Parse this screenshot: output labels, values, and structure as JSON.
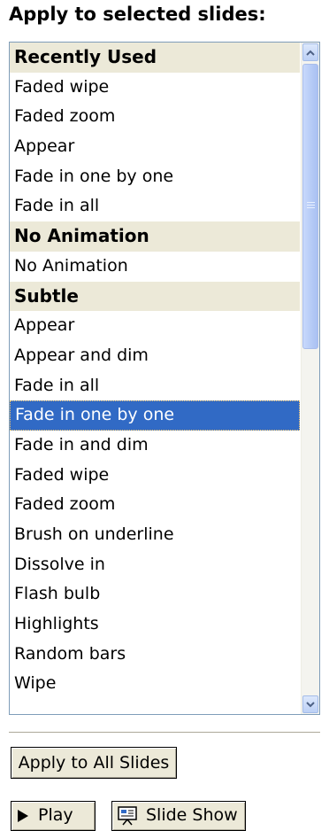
{
  "heading": "Apply to selected slides:",
  "list": {
    "rows": [
      {
        "text": "Recently Used",
        "kind": "group"
      },
      {
        "text": "Faded wipe",
        "kind": "item"
      },
      {
        "text": "Faded zoom",
        "kind": "item"
      },
      {
        "text": "Appear",
        "kind": "item"
      },
      {
        "text": "Fade in one by one",
        "kind": "item"
      },
      {
        "text": "Fade in all",
        "kind": "item"
      },
      {
        "text": "No Animation",
        "kind": "group"
      },
      {
        "text": "No Animation",
        "kind": "item"
      },
      {
        "text": "Subtle",
        "kind": "group"
      },
      {
        "text": "Appear",
        "kind": "item"
      },
      {
        "text": "Appear and dim",
        "kind": "item"
      },
      {
        "text": "Fade in all",
        "kind": "item"
      },
      {
        "text": "Fade in one by one",
        "kind": "item",
        "selected": true
      },
      {
        "text": "Fade in and dim",
        "kind": "item"
      },
      {
        "text": "Faded wipe",
        "kind": "item"
      },
      {
        "text": "Faded zoom",
        "kind": "item"
      },
      {
        "text": "Brush on underline",
        "kind": "item"
      },
      {
        "text": "Dissolve in",
        "kind": "item"
      },
      {
        "text": "Flash bulb",
        "kind": "item"
      },
      {
        "text": "Highlights",
        "kind": "item"
      },
      {
        "text": "Random bars",
        "kind": "item"
      },
      {
        "text": "Wipe",
        "kind": "item"
      }
    ],
    "selected_value": "Fade in one by one"
  },
  "scrollbar": {
    "up_icon": "chevron-up-icon",
    "down_icon": "chevron-down-icon"
  },
  "buttons": {
    "apply_all": "Apply to All Slides",
    "play": "Play",
    "play_icon": "play-triangle-icon",
    "slide_show": "Slide Show",
    "slide_show_icon": "slide-show-screen-icon"
  },
  "colors": {
    "selection": "#316ac5",
    "group_header": "#ece9d8",
    "list_border": "#7f9db9",
    "scrollbar_thumb": "#b6cbf6"
  }
}
